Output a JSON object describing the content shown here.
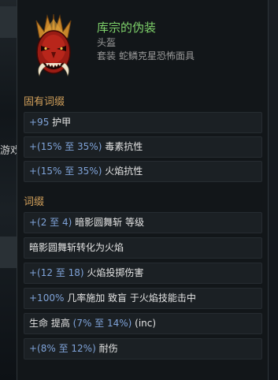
{
  "background": {
    "left_fragment": "游戏"
  },
  "item": {
    "name": "库宗的伪装",
    "type": "头盔",
    "set_label": "套装",
    "set_name": "蛇鳞克星恐怖面具",
    "icon": "red-demon-mask-icon"
  },
  "colors": {
    "item_name": "#7fd36b",
    "section_title": "#d3a15c",
    "value": "#7fa3d9",
    "text": "#e4e4e4",
    "row_bg": "#1b2024"
  },
  "implicit": {
    "title": "固有词缀",
    "stats": [
      {
        "parts": [
          {
            "t": "+95",
            "c": "v"
          },
          {
            "t": " 护甲",
            "c": "w"
          }
        ]
      },
      {
        "parts": [
          {
            "t": "+(15% 至 35%)",
            "c": "v"
          },
          {
            "t": " 毒素抗性",
            "c": "w"
          }
        ]
      },
      {
        "parts": [
          {
            "t": "+(15% 至 35%)",
            "c": "v"
          },
          {
            "t": " 火焰抗性",
            "c": "w"
          }
        ]
      }
    ]
  },
  "affixes": {
    "title": "词缀",
    "stats": [
      {
        "parts": [
          {
            "t": "+(2 至 4)",
            "c": "v"
          },
          {
            "t": " 暗影圆舞斩 等级",
            "c": "w"
          }
        ]
      },
      {
        "parts": [
          {
            "t": "暗影圆舞斩转化为火焰",
            "c": "w"
          }
        ]
      },
      {
        "parts": [
          {
            "t": "+(12 至 18)",
            "c": "v"
          },
          {
            "t": " 火焰投掷伤害",
            "c": "w"
          }
        ]
      },
      {
        "parts": [
          {
            "t": "+100%",
            "c": "v"
          },
          {
            "t": " 几率施加 致盲 于火焰技能击中",
            "c": "w"
          }
        ]
      },
      {
        "parts": [
          {
            "t": "生命 提高 ",
            "c": "w"
          },
          {
            "t": "(7% 至 14%)",
            "c": "v"
          },
          {
            "t": " (inc)",
            "c": "w"
          }
        ]
      },
      {
        "parts": [
          {
            "t": "+(8% 至 12%)",
            "c": "v"
          },
          {
            "t": " 耐伤",
            "c": "w"
          }
        ]
      }
    ]
  }
}
